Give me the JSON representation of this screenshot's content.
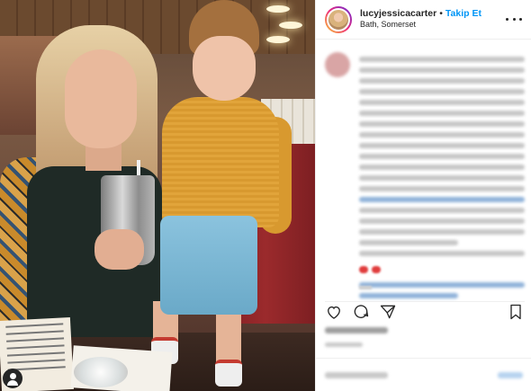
{
  "post": {
    "username": "lucyjessicacarter",
    "separator": "•",
    "follow_label": "Takip Et",
    "location": "Bath, Somerset"
  },
  "icons": {
    "more": "more-options-icon",
    "like": "heart-icon",
    "comment": "comment-bubble-icon",
    "share": "share-icon",
    "save": "bookmark-icon",
    "account": "account-icon"
  },
  "colors": {
    "follow_blue": "#0095f6",
    "text": "#262626",
    "border": "#efefef"
  }
}
